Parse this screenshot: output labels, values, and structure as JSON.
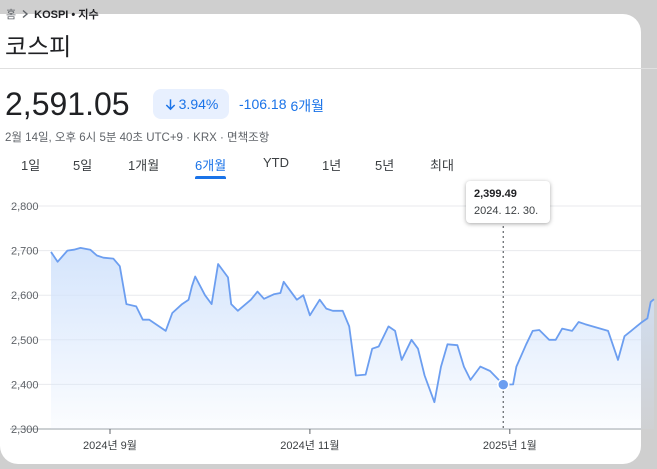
{
  "breadcrumb": {
    "home": "홈",
    "item": "KOSPI • 지수"
  },
  "title": "코스피",
  "quote": {
    "price": "2,591.05",
    "change_pct": "3.94%",
    "change_abs": "-106.18",
    "period": "6개월",
    "timestamp": "2월 14일, 오후 6시 5분 40초 UTC+9 · KRX · 면책조항"
  },
  "tabs": [
    {
      "label": "1일"
    },
    {
      "label": "5일"
    },
    {
      "label": "1개월"
    },
    {
      "label": "6개월"
    },
    {
      "label": "YTD"
    },
    {
      "label": "1년"
    },
    {
      "label": "5년"
    },
    {
      "label": "최대"
    }
  ],
  "active_tab": "6개월",
  "tooltip": {
    "value": "2,399.49",
    "date": "2024. 12. 30."
  },
  "colors": {
    "accent": "#1a73e8",
    "line": "#6c9ef0",
    "fill": "#d2e3fc",
    "background": "#cfcfcf"
  },
  "chart_data": {
    "type": "area",
    "ylim": [
      2300,
      2800
    ],
    "yticks": [
      2300,
      2400,
      2500,
      2600,
      2700,
      2800
    ],
    "ytick_labels": [
      "2,300",
      "2,400",
      "2,500",
      "2,600",
      "2,700",
      "2,800"
    ],
    "xticks": [
      {
        "label": "2024년 9월",
        "date": "2024-09-01"
      },
      {
        "label": "2024년 11월",
        "date": "2024-11-01"
      },
      {
        "label": "2025년 1월",
        "date": "2025-01-01"
      }
    ],
    "grid": true,
    "highlight": {
      "date": "2024-12-30",
      "value": 2399.49
    },
    "series": [
      {
        "points": [
          [
            "2024-08-14",
            2697
          ],
          [
            "2024-08-16",
            2675
          ],
          [
            "2024-08-19",
            2700
          ],
          [
            "2024-08-21",
            2702
          ],
          [
            "2024-08-23",
            2706
          ],
          [
            "2024-08-26",
            2702
          ],
          [
            "2024-08-28",
            2689
          ],
          [
            "2024-08-30",
            2684
          ],
          [
            "2024-09-02",
            2682
          ],
          [
            "2024-09-04",
            2665
          ],
          [
            "2024-09-06",
            2580
          ],
          [
            "2024-09-09",
            2575
          ],
          [
            "2024-09-11",
            2545
          ],
          [
            "2024-09-13",
            2545
          ],
          [
            "2024-09-18",
            2520
          ],
          [
            "2024-09-20",
            2560
          ],
          [
            "2024-09-23",
            2580
          ],
          [
            "2024-09-25",
            2590
          ],
          [
            "2024-09-26",
            2620
          ],
          [
            "2024-09-27",
            2642
          ],
          [
            "2024-09-30",
            2600
          ],
          [
            "2024-10-02",
            2580
          ],
          [
            "2024-10-04",
            2670
          ],
          [
            "2024-10-07",
            2640
          ],
          [
            "2024-10-08",
            2580
          ],
          [
            "2024-10-10",
            2565
          ],
          [
            "2024-10-14",
            2590
          ],
          [
            "2024-10-16",
            2608
          ],
          [
            "2024-10-18",
            2592
          ],
          [
            "2024-10-21",
            2602
          ],
          [
            "2024-10-23",
            2605
          ],
          [
            "2024-10-24",
            2630
          ],
          [
            "2024-10-25",
            2620
          ],
          [
            "2024-10-28",
            2590
          ],
          [
            "2024-10-30",
            2600
          ],
          [
            "2024-11-01",
            2555
          ],
          [
            "2024-11-04",
            2590
          ],
          [
            "2024-11-06",
            2570
          ],
          [
            "2024-11-08",
            2565
          ],
          [
            "2024-11-11",
            2565
          ],
          [
            "2024-11-13",
            2530
          ],
          [
            "2024-11-15",
            2420
          ],
          [
            "2024-11-18",
            2422
          ],
          [
            "2024-11-20",
            2480
          ],
          [
            "2024-11-22",
            2485
          ],
          [
            "2024-11-25",
            2530
          ],
          [
            "2024-11-27",
            2520
          ],
          [
            "2024-11-29",
            2455
          ],
          [
            "2024-12-02",
            2500
          ],
          [
            "2024-12-04",
            2480
          ],
          [
            "2024-12-06",
            2420
          ],
          [
            "2024-12-09",
            2360
          ],
          [
            "2024-12-11",
            2440
          ],
          [
            "2024-12-13",
            2490
          ],
          [
            "2024-12-16",
            2488
          ],
          [
            "2024-12-18",
            2440
          ],
          [
            "2024-12-20",
            2410
          ],
          [
            "2024-12-23",
            2440
          ],
          [
            "2024-12-26",
            2430
          ],
          [
            "2024-12-30",
            2399.49
          ],
          [
            "2025-01-02",
            2400
          ],
          [
            "2025-01-03",
            2440
          ],
          [
            "2025-01-06",
            2490
          ],
          [
            "2025-01-08",
            2520
          ],
          [
            "2025-01-10",
            2522
          ],
          [
            "2025-01-13",
            2500
          ],
          [
            "2025-01-15",
            2500
          ],
          [
            "2025-01-17",
            2525
          ],
          [
            "2025-01-20",
            2520
          ],
          [
            "2025-01-22",
            2540
          ],
          [
            "2025-01-24",
            2535
          ],
          [
            "2025-01-31",
            2520
          ],
          [
            "2025-02-03",
            2455
          ],
          [
            "2025-02-05",
            2508
          ],
          [
            "2025-02-07",
            2520
          ],
          [
            "2025-02-10",
            2538
          ],
          [
            "2025-02-12",
            2548
          ],
          [
            "2025-02-13",
            2585
          ],
          [
            "2025-02-14",
            2591.05
          ]
        ]
      }
    ]
  }
}
